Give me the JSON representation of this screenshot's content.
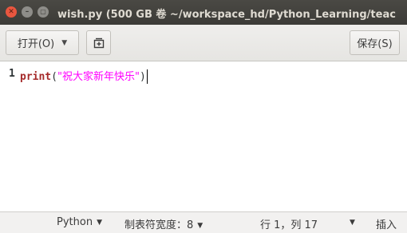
{
  "window": {
    "title": "wish.py (500 GB 卷 ~/workspace_hd/Python_Learning/teac",
    "close_glyph": "✕",
    "minimize_glyph": "–",
    "maximize_glyph": "▢"
  },
  "toolbar": {
    "open_label": "打开(O)",
    "open_arrow": "▼",
    "new_tab_icon_glyph": "⊞",
    "save_label": "保存(S)"
  },
  "editor": {
    "line_numbers": [
      "1"
    ],
    "line1": {
      "keyword": "print",
      "open_paren": "(",
      "string": "\"祝大家新年快乐\"",
      "close_paren": ")"
    }
  },
  "statusbar": {
    "language": "Python",
    "tab_width": "制表符宽度：8",
    "position": "行 1，列 17",
    "mode": "插入",
    "dropdown_glyph": "▼"
  }
}
